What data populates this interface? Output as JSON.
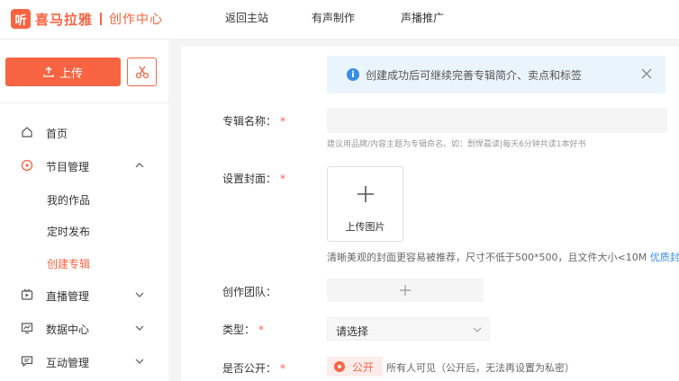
{
  "header": {
    "logo_mark": "听",
    "logo_text": "喜马拉雅",
    "logo_sub": "创作中心",
    "nav": [
      "返回主站",
      "有声制作",
      "声播推广"
    ]
  },
  "sidebar": {
    "upload_label": "上传",
    "menu": [
      {
        "label": "首页",
        "icon": "home-icon"
      },
      {
        "label": "节目管理",
        "icon": "program-icon"
      },
      {
        "label": "直播管理",
        "icon": "live-icon"
      },
      {
        "label": "数据中心",
        "icon": "chart-icon"
      },
      {
        "label": "互动管理",
        "icon": "chat-icon"
      }
    ],
    "submenu": [
      "我的作品",
      "定时发布",
      "创建专辑"
    ]
  },
  "notice": {
    "text": "创建成功后可继续完善专辑简介、卖点和标签"
  },
  "form": {
    "album_name_label": "专辑名称：",
    "required_mark": "*",
    "album_name_hint": "建议用品牌/内容主题为专辑命名。如：剽悍晨读|每天6分钟共读1本好书",
    "cover_label": "设置封面：",
    "cover_upload_text": "上传图片",
    "cover_hint": "清晰美观的封面更容易被推荐，尺寸不低于500*500，且文件大小<10M",
    "cover_hint_link": "优质封",
    "team_label": "创作团队：",
    "type_label": "类型：",
    "type_placeholder": "请选择",
    "public_label": "是否公开：",
    "public_option": "公开",
    "public_desc": "所有人可见（公开后，无法再设置为私密）"
  },
  "colors": {
    "accent": "#f86442",
    "info_blue": "#3a8ee6",
    "notice_bg": "#eaf4fd"
  }
}
